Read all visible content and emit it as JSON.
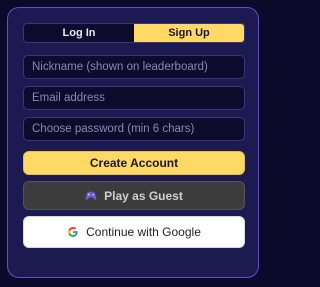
{
  "auth": {
    "tabs": [
      {
        "label": "Log In",
        "active": false
      },
      {
        "label": "Sign Up",
        "active": true
      }
    ],
    "fields": {
      "nickname": {
        "placeholder": "Nickname (shown on leaderboard)",
        "value": ""
      },
      "email": {
        "placeholder": "Email address",
        "value": ""
      },
      "password": {
        "placeholder": "Choose password (min 6 chars)",
        "value": ""
      }
    },
    "buttons": {
      "create": "Create Account",
      "guest": "Play as Guest",
      "google": "Continue with Google"
    },
    "icons": {
      "guest": "gamepad-icon",
      "google": "google-icon"
    }
  },
  "colors": {
    "accent": "#ffd964",
    "card_bg": "#1d1a52",
    "card_border": "#5b53c4",
    "field_bg": "#0e0c2c"
  }
}
